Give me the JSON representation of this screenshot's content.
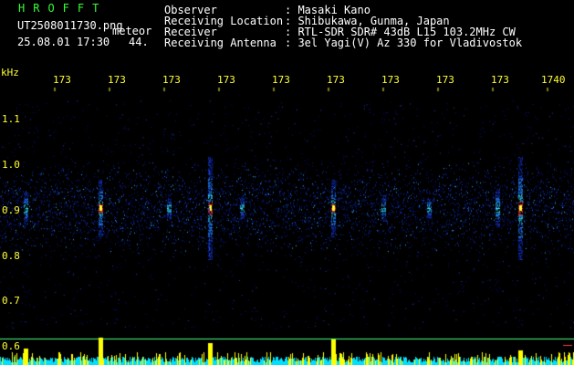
{
  "app": {
    "brand": "HROFFT",
    "filename": "UT2508011730.png",
    "meteor_label": "meteor",
    "datetime": "25.08.01 17:30",
    "meteor_count": "44."
  },
  "header": {
    "fields": [
      {
        "label": "Observer",
        "value": ": Masaki Kano"
      },
      {
        "label": "Receiving Location",
        "value": ": Shibukawa, Gunma, Japan"
      },
      {
        "label": "Receiver",
        "value": ": RTL-SDR SDR# 43dB L15 103.2MHz CW"
      },
      {
        "label": "Receiving Antenna",
        "value": ": 3el Yagi(V) Az 330 for Vladivostok"
      }
    ]
  },
  "axes": {
    "y_unit": "kHz",
    "y_ticks": [
      "1.1",
      "1.0",
      "0.9",
      "0.8",
      "0.7",
      "0.6"
    ],
    "x_ticks": [
      "173",
      "173",
      "173",
      "173",
      "173",
      "173",
      "173",
      "173",
      "173",
      "1740"
    ]
  },
  "colors": {
    "brand": "#33ff33",
    "tick": "#ffff33",
    "text": "#ffffff",
    "noise": "#0a1a90",
    "echo": "#ff3030",
    "bars": "#ffff00",
    "baseline": "#00e0ff"
  }
}
